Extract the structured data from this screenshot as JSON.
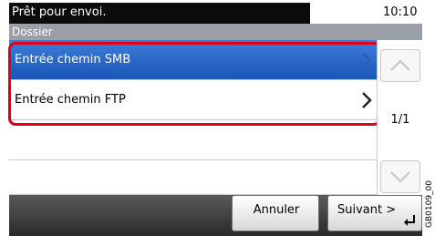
{
  "status": {
    "message": "Prêt pour envoi.",
    "time": "10:10"
  },
  "screen": {
    "title": "Dossier"
  },
  "list": {
    "items": [
      {
        "label": "Entrée chemin SMB"
      },
      {
        "label": "Entrée chemin FTP"
      }
    ]
  },
  "pagination": {
    "indicator": "1/1"
  },
  "footer": {
    "cancel_label": "Annuler",
    "next_label": "Suivant >"
  },
  "side_code": "GB0109_00",
  "colors": {
    "selected_row": "#1a57b8",
    "highlight_border": "#e0001a",
    "status_bar": "#0c0c0c",
    "title_bar": "#9aa0a6"
  }
}
